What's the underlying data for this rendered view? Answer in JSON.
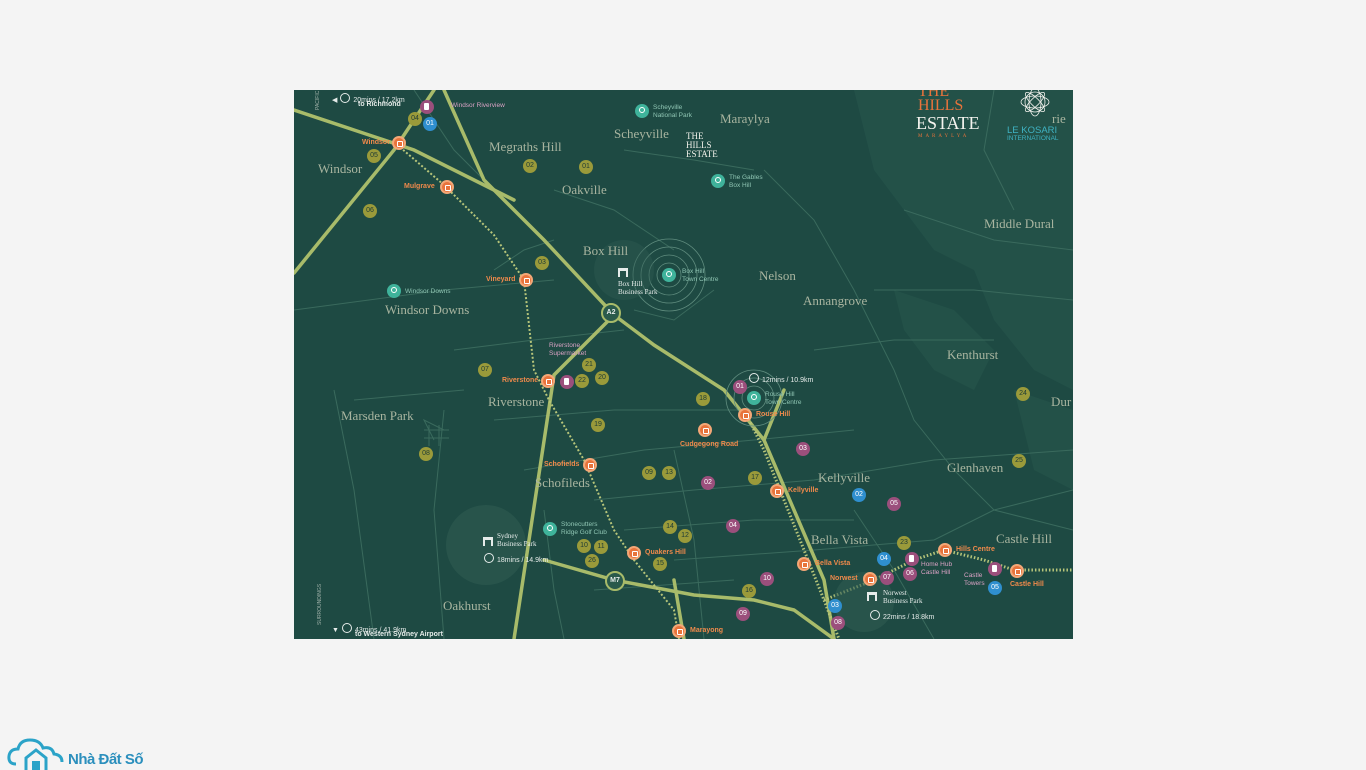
{
  "map": {
    "areas": [
      {
        "id": "megraths-hill",
        "label": "Megraths Hill"
      },
      {
        "id": "scheyville",
        "label": "Scheyville"
      },
      {
        "id": "maraylya",
        "label": "Maraylya"
      },
      {
        "id": "windsor",
        "label": "Windsor"
      },
      {
        "id": "oakville",
        "label": "Oakville"
      },
      {
        "id": "box-hill",
        "label": "Box Hill"
      },
      {
        "id": "middle-dural",
        "label": "Middle Dural"
      },
      {
        "id": "nelson",
        "label": "Nelson"
      },
      {
        "id": "annangrove",
        "label": "Annangrove"
      },
      {
        "id": "windsor-downs",
        "label": "Windsor Downs"
      },
      {
        "id": "kenthurst",
        "label": "Kenthurst"
      },
      {
        "id": "marsden-park",
        "label": "Marsden Park"
      },
      {
        "id": "riverstone",
        "label": "Riverstone"
      },
      {
        "id": "dur",
        "label": "Dur"
      },
      {
        "id": "glenhaven",
        "label": "Glenhaven"
      },
      {
        "id": "kellyville",
        "label": "Kellyville"
      },
      {
        "id": "schofields",
        "label": "Schofileds"
      },
      {
        "id": "bella-vista",
        "label": "Bella Vista"
      },
      {
        "id": "castle-hill",
        "label": "Castle Hill"
      },
      {
        "id": "oakhurst",
        "label": "Oakhurst"
      }
    ],
    "stations": [
      {
        "id": "windsor",
        "label": "Windsor"
      },
      {
        "id": "mulgrave",
        "label": "Mulgrave"
      },
      {
        "id": "vineyard",
        "label": "Vineyard"
      },
      {
        "id": "riverstone",
        "label": "Riverstone"
      },
      {
        "id": "schofields",
        "label": "Schofields"
      },
      {
        "id": "quakers-hill",
        "label": "Quakers Hill"
      },
      {
        "id": "marayong",
        "label": "Marayong"
      },
      {
        "id": "rouse-hill",
        "label": "Rouse Hill"
      },
      {
        "id": "cudgegong-road",
        "label": "Cudgegong Road"
      },
      {
        "id": "kellyville",
        "label": "Kellyville"
      },
      {
        "id": "bella-vista",
        "label": "Bella Vista"
      },
      {
        "id": "norwest",
        "label": "Norwest"
      },
      {
        "id": "hills-centre",
        "label": "Hills Centre"
      },
      {
        "id": "castle-hill",
        "label": "Castle Hill"
      }
    ],
    "places": {
      "scheyville_np": "Scheyville\nNational Park",
      "gables": "The Gables\nBox Hill",
      "box_hill_town": "Box Hill\nTown Centre",
      "windsor_downs": "Windsor Downs",
      "rouse_hill_town": "Rouse Hill\nTown Centre",
      "stonecutters": "Stonecutters\nRidge Golf Club",
      "windsor_riverview": "Windsor Riverview",
      "riverstone_super": "Riverstone\nSupermarket",
      "home_hub": "Home Hub\nCastle Hill",
      "castle_towers": "Castle\nTowers"
    },
    "business": {
      "box_hill_bp": "Box Hill\nBusiness Park",
      "sydney_bp": "Sydney\nBusiness Park",
      "norwest_bp": "Norwest\nBusiness Park"
    },
    "times": {
      "richmond_time": "20mins / 17.2km",
      "richmond_to": "to Richmond",
      "rouse_time": "12mins / 10.9km",
      "sydney_bp_time": "18mins / 14.9km",
      "norwest_time": "22mins / 18.8km",
      "airport_time": "43mins / 41.9km",
      "airport_to": "to Western Sydney Airport"
    },
    "roads": {
      "a2": "A2",
      "m7": "M7"
    },
    "edge_labels": {
      "pacific": "PACIFIC",
      "surroundings": "SURROUNDINGS"
    },
    "center_logo": "THE\nHILLS\nESTATE",
    "colors": {
      "background": "#1e4a43",
      "road": "#a8bb6a",
      "station": "#e8733b",
      "school": "#9a9a3a",
      "shopping": "#9b4f7c",
      "hospital": "#2f8fcf",
      "park": "#3fb39b"
    }
  },
  "brand": {
    "estate_title_top": "THE",
    "estate_title_hills": "HILLS",
    "estate_title_estate": "ESTATE",
    "estate_subtitle": "MARAYLYA",
    "partner_line1": "LE KOSARI",
    "partner_line2": "INTERNATIONAL",
    "corner_cut": "rie"
  },
  "watermark": {
    "text": "Nhà Đất Số"
  }
}
